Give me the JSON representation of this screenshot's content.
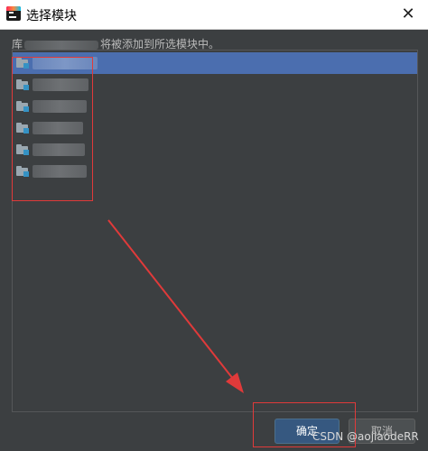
{
  "window": {
    "title": "选择模块",
    "close_glyph": "✕",
    "app_icon": "intellij-idea-icon"
  },
  "description": {
    "prefix": "库",
    "suffix": "将被添加到所选模块中。"
  },
  "module_list": {
    "selected_index": 0,
    "item_icon": "module-folder-icon"
  },
  "buttons": {
    "ok_label": "确定",
    "cancel_label": "取消"
  },
  "watermark": "CSDN @aojiaodeRR",
  "colors": {
    "background": "#3c3f41",
    "selection": "#4b6eaf",
    "primary_button": "#365880",
    "annotation_red": "#e03a3a"
  }
}
